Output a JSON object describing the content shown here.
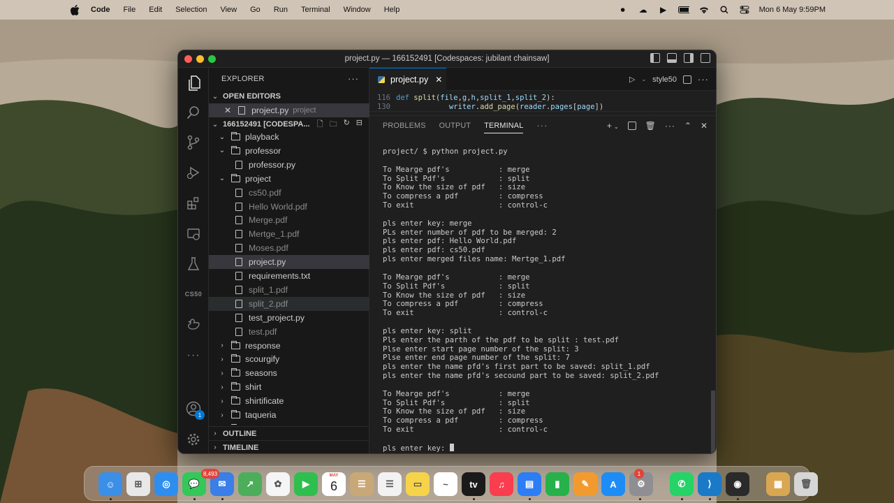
{
  "menubar": {
    "app_name": "Code",
    "menus": [
      "File",
      "Edit",
      "Selection",
      "View",
      "Go",
      "Run",
      "Terminal",
      "Window",
      "Help"
    ],
    "datetime": "Mon 6 May  9:59PM"
  },
  "window": {
    "title": "project.py — 166152491 [Codespaces: jubilant chainsaw]"
  },
  "sidebar": {
    "title": "EXPLORER",
    "open_editors_header": "OPEN EDITORS",
    "open_editor": {
      "name": "project.py",
      "folder": "project"
    },
    "workspace_header": "166152491 [CODESPA...",
    "tree": [
      {
        "label": "playback",
        "kind": "folder",
        "depth": 1,
        "open": true
      },
      {
        "label": "professor",
        "kind": "folder",
        "depth": 1,
        "open": true
      },
      {
        "label": "professor.py",
        "kind": "file",
        "depth": 2,
        "dim": false
      },
      {
        "label": "project",
        "kind": "folder",
        "depth": 1,
        "open": true
      },
      {
        "label": "cs50.pdf",
        "kind": "file",
        "depth": 2,
        "dim": true
      },
      {
        "label": "Hello World.pdf",
        "kind": "file",
        "depth": 2,
        "dim": true
      },
      {
        "label": "Merge.pdf",
        "kind": "file",
        "depth": 2,
        "dim": true
      },
      {
        "label": "Mertge_1.pdf",
        "kind": "file",
        "depth": 2,
        "dim": true
      },
      {
        "label": "Moses.pdf",
        "kind": "file",
        "depth": 2,
        "dim": true
      },
      {
        "label": "project.py",
        "kind": "file",
        "depth": 2,
        "dim": false,
        "selected": true
      },
      {
        "label": "requirements.txt",
        "kind": "file",
        "depth": 2,
        "dim": false
      },
      {
        "label": "split_1.pdf",
        "kind": "file",
        "depth": 2,
        "dim": true
      },
      {
        "label": "split_2.pdf",
        "kind": "file",
        "depth": 2,
        "dim": true,
        "hover": true
      },
      {
        "label": "test_project.py",
        "kind": "file",
        "depth": 2,
        "dim": false
      },
      {
        "label": "test.pdf",
        "kind": "file",
        "depth": 2,
        "dim": true
      },
      {
        "label": "response",
        "kind": "folder",
        "depth": 1,
        "open": false
      },
      {
        "label": "scourgify",
        "kind": "folder",
        "depth": 1,
        "open": false
      },
      {
        "label": "seasons",
        "kind": "folder",
        "depth": 1,
        "open": false
      },
      {
        "label": "shirt",
        "kind": "folder",
        "depth": 1,
        "open": false
      },
      {
        "label": "shirtificate",
        "kind": "folder",
        "depth": 1,
        "open": false
      },
      {
        "label": "taqueria",
        "kind": "folder",
        "depth": 1,
        "open": false
      },
      {
        "label": "test_bank",
        "kind": "folder",
        "depth": 1,
        "open": false
      }
    ],
    "outline_header": "OUTLINE",
    "timeline_header": "TIMELINE"
  },
  "activity": {
    "cs50_label": "CS50",
    "accounts_badge": "1"
  },
  "editor": {
    "tab_label": "project.py",
    "run_profile": "style50",
    "lines": [
      {
        "num": "116",
        "text": "def split(file,g,h,split_1,split_2):"
      },
      {
        "num": "130",
        "text": "            writer.add_page(reader.pages[page])"
      }
    ]
  },
  "panel": {
    "tabs": [
      "PROBLEMS",
      "OUTPUT",
      "TERMINAL"
    ],
    "active_tab": "TERMINAL",
    "terminal_lines": [
      "project/ $ python project.py",
      "",
      "To Mearge pdf's           : merge",
      "To Split Pdf's            : split",
      "To Know the size of pdf   : size",
      "To compress a pdf         : compress",
      "To exit                   : control-c",
      "",
      "pls enter key: merge",
      "PLs enter number of pdf to be merged: 2",
      "pls enter pdf: Hello World.pdf",
      "pls enter pdf: cs50.pdf",
      "pls enter merged files name: Mertge_1.pdf",
      "",
      "To Mearge pdf's           : merge",
      "To Split Pdf's            : split",
      "To Know the size of pdf   : size",
      "To compress a pdf         : compress",
      "To exit                   : control-c",
      "",
      "pls enter key: split",
      "Pls enter the parth of the pdf to be split : test.pdf",
      "Plse enter start page number of the split: 3",
      "Plse enter end page number of the split: 7",
      "pls enter the name pfd's first part to be saved: split_1.pdf",
      "pls enter the name pfd's secound part to be saved: split_2.pdf",
      "",
      "To Mearge pdf's           : merge",
      "To Split Pdf's            : split",
      "To Know the size of pdf   : size",
      "To compress a pdf         : compress",
      "To exit                   : control-c",
      "",
      "pls enter key: "
    ]
  },
  "dock": {
    "apps": [
      "Finder",
      "Launchpad",
      "Safari",
      "Messages",
      "Mail",
      "Maps",
      "Photos",
      "FaceTime",
      "Calendar",
      "Contacts",
      "Reminders",
      "Notes",
      "Freeform",
      "TV",
      "Music",
      "Keynote",
      "Numbers",
      "Pages",
      "App Store",
      "System Settings",
      "WhatsApp",
      "Visual Studio Code",
      "QuickTime Player",
      "Archive",
      "Trash"
    ],
    "mail_badge": "8,493",
    "settings_badge": "1",
    "calendar_day": "6",
    "calendar_month": "MAY",
    "tv_label": "tv"
  }
}
